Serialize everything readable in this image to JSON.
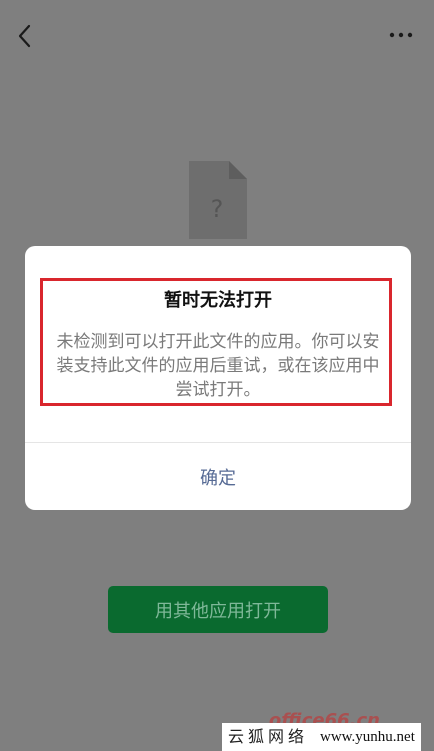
{
  "dialog": {
    "title": "暂时无法打开",
    "message": "未检测到可以打开此文件的应用。你可以安装支持此文件的应用后重试，或在该应用中尝试打开。",
    "confirm_label": "确定"
  },
  "file": {
    "placeholder_glyph": "?"
  },
  "bottom": {
    "open_with_label": "用其他应用打开"
  },
  "watermark": {
    "text_cn": "云狐网络",
    "text_en": "www.yunhu.net",
    "faint_text": "office66.cn"
  },
  "colors": {
    "overlay_bg": "#7f7f7f",
    "dialog_bg": "#ffffff",
    "highlight_border": "#d9262d",
    "confirm_text": "#576b95",
    "green_button": "#0a6a2f"
  }
}
